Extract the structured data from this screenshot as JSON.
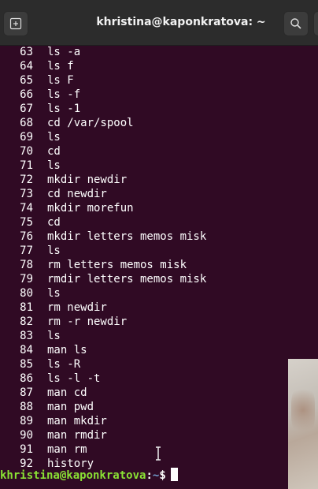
{
  "window": {
    "title": "khristina@kaponkratova: ~",
    "icons": {
      "new_tab": "new-tab-icon",
      "search": "search-icon"
    }
  },
  "history": [
    {
      "n": "63",
      "cmd": "ls -a"
    },
    {
      "n": "64",
      "cmd": "ls f"
    },
    {
      "n": "65",
      "cmd": "ls F"
    },
    {
      "n": "66",
      "cmd": "ls -f"
    },
    {
      "n": "67",
      "cmd": "ls -1"
    },
    {
      "n": "68",
      "cmd": "cd /var/spool"
    },
    {
      "n": "69",
      "cmd": "ls"
    },
    {
      "n": "70",
      "cmd": "cd"
    },
    {
      "n": "71",
      "cmd": "ls"
    },
    {
      "n": "72",
      "cmd": "mkdir newdir"
    },
    {
      "n": "73",
      "cmd": "cd newdir"
    },
    {
      "n": "74",
      "cmd": "mkdir morefun"
    },
    {
      "n": "75",
      "cmd": "cd"
    },
    {
      "n": "76",
      "cmd": "mkdir letters memos misk"
    },
    {
      "n": "77",
      "cmd": "ls"
    },
    {
      "n": "78",
      "cmd": "rm letters memos misk"
    },
    {
      "n": "79",
      "cmd": "rmdir letters memos misk"
    },
    {
      "n": "80",
      "cmd": "ls"
    },
    {
      "n": "81",
      "cmd": "rm newdir"
    },
    {
      "n": "82",
      "cmd": "rm -r newdir"
    },
    {
      "n": "83",
      "cmd": "ls"
    },
    {
      "n": "84",
      "cmd": "man ls"
    },
    {
      "n": "85",
      "cmd": "ls -R"
    },
    {
      "n": "86",
      "cmd": "ls -l -t"
    },
    {
      "n": "87",
      "cmd": "man cd"
    },
    {
      "n": "88",
      "cmd": "man pwd"
    },
    {
      "n": "89",
      "cmd": "man mkdir"
    },
    {
      "n": "90",
      "cmd": "man rmdir"
    },
    {
      "n": "91",
      "cmd": "man rm"
    },
    {
      "n": "92",
      "cmd": "history"
    }
  ],
  "prompt": {
    "user_host": "khristina@kaponkratova",
    "colon": ":",
    "path": "~",
    "dollar": "$"
  },
  "colors": {
    "background": "#300a24",
    "prompt_user": "#8ae234",
    "prompt_path": "#729fcf"
  }
}
